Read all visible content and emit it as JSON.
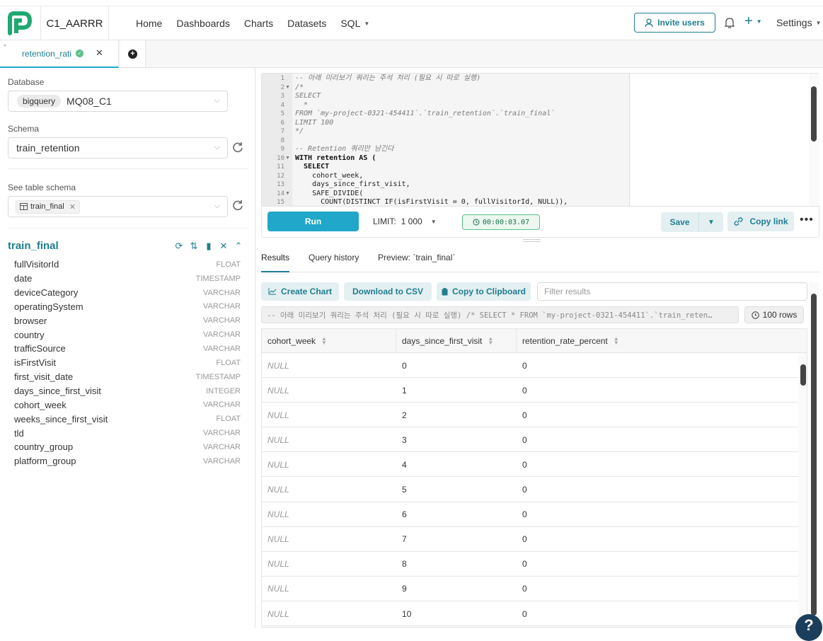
{
  "app": {
    "name": "C1_AARRR"
  },
  "nav": {
    "items": [
      "Home",
      "Dashboards",
      "Charts",
      "Datasets",
      "SQL"
    ]
  },
  "header": {
    "invite_label": "Invite users",
    "settings_label": "Settings"
  },
  "tabs": {
    "active_label": "retention_rati"
  },
  "left": {
    "database_label": "Database",
    "database_engine": "bigquery",
    "database_name": "MQ08_C1",
    "schema_label": "Schema",
    "schema_value": "train_retention",
    "table_schema_label": "See table schema",
    "table_tag": "train_final",
    "table_title": "train_final",
    "columns": [
      {
        "name": "fullVisitorId",
        "type": "FLOAT"
      },
      {
        "name": "date",
        "type": "TIMESTAMP"
      },
      {
        "name": "deviceCategory",
        "type": "VARCHAR"
      },
      {
        "name": "operatingSystem",
        "type": "VARCHAR"
      },
      {
        "name": "browser",
        "type": "VARCHAR"
      },
      {
        "name": "country",
        "type": "VARCHAR"
      },
      {
        "name": "trafficSource",
        "type": "VARCHAR"
      },
      {
        "name": "isFirstVisit",
        "type": "FLOAT"
      },
      {
        "name": "first_visit_date",
        "type": "TIMESTAMP"
      },
      {
        "name": "days_since_first_visit",
        "type": "INTEGER"
      },
      {
        "name": "cohort_week",
        "type": "VARCHAR"
      },
      {
        "name": "weeks_since_first_visit",
        "type": "FLOAT"
      },
      {
        "name": "tld",
        "type": "VARCHAR"
      },
      {
        "name": "country_group",
        "type": "VARCHAR"
      },
      {
        "name": "platform_group",
        "type": "VARCHAR"
      }
    ]
  },
  "editor": {
    "lines": [
      "-- 아래 미리보기 쿼리는 주석 처리 (필요 시 따로 실행)",
      "/*",
      "SELECT",
      "  *",
      "FROM `my-project-0321-454411`.`train_retention`.`train_final`",
      "LIMIT 100",
      "*/",
      "",
      "-- Retention 쿼리만 남긴다",
      "WITH retention AS (",
      "  SELECT",
      "    cohort_week,",
      "    days_since_first_visit,",
      "    SAFE_DIVIDE(",
      "      COUNT(DISTINCT IF(isFirstVisit = 0, fullVisitorId, NULL)),"
    ]
  },
  "toolbar": {
    "run_label": "Run",
    "limit_label": "LIMIT:",
    "limit_value": "1 000",
    "timer": "00:00:03.07",
    "save_label": "Save",
    "copy_link_label": "Copy link"
  },
  "results": {
    "tabs": [
      "Results",
      "Query history",
      "Preview: `train_final`"
    ],
    "create_chart_label": "Create Chart",
    "download_csv_label": "Download to CSV",
    "copy_clipboard_label": "Copy to Clipboard",
    "filter_placeholder": "Filter results",
    "query_echo": "-- 아래 미리보기 쿼리는 주석 처리 (필요 시 따로 실행) /* SELECT * FROM `my-project-0321-454411`.`train_reten…",
    "rows_label": "100 rows",
    "columns": [
      "cohort_week",
      "days_since_first_visit",
      "retention_rate_percent"
    ],
    "rows": [
      [
        "NULL",
        "0",
        "0"
      ],
      [
        "NULL",
        "1",
        "0"
      ],
      [
        "NULL",
        "2",
        "0"
      ],
      [
        "NULL",
        "3",
        "0"
      ],
      [
        "NULL",
        "4",
        "0"
      ],
      [
        "NULL",
        "5",
        "0"
      ],
      [
        "NULL",
        "6",
        "0"
      ],
      [
        "NULL",
        "7",
        "0"
      ],
      [
        "NULL",
        "8",
        "0"
      ],
      [
        "NULL",
        "9",
        "0"
      ],
      [
        "NULL",
        "10",
        "0"
      ]
    ]
  },
  "colors": {
    "accent": "#1f7e8f",
    "run": "#20a7c9",
    "logo": "#20a870"
  }
}
